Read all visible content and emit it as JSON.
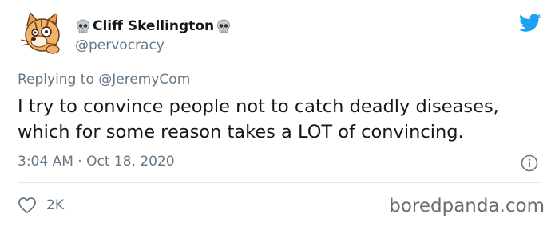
{
  "tweet": {
    "author": {
      "display_name": "Cliff Skellington",
      "handle": "@pervocracy",
      "name_decoration": "skull-icon"
    },
    "reply_prefix": "Replying to",
    "reply_to": "@JeremyCom",
    "text": "I try to convince people not to catch deadly diseases, which for some reason takes a LOT of convincing.",
    "timestamp": "3:04 AM · Oct 18, 2020",
    "likes": "2K"
  },
  "icons": {
    "brand": "twitter-bird-icon",
    "info": "info-icon",
    "like": "heart-icon"
  },
  "colors": {
    "twitter_blue": "#1da1f2",
    "secondary_text": "#657786",
    "primary_text": "#14171a",
    "divider": "#e1e8ed"
  },
  "watermark": "boredpanda.com"
}
